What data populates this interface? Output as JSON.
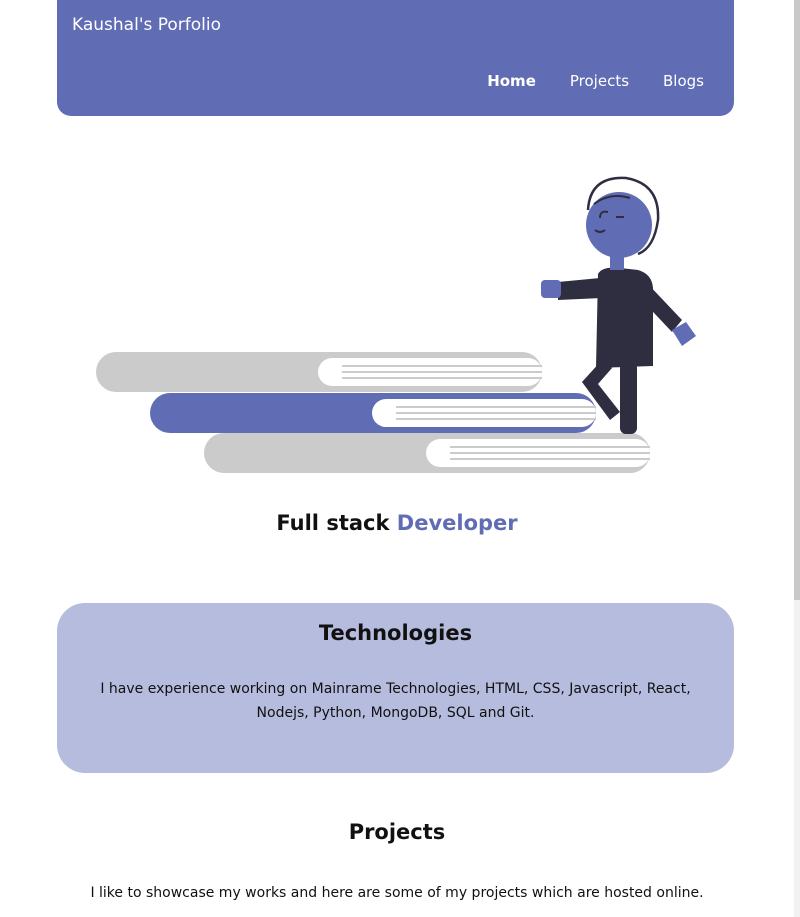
{
  "navbar": {
    "brand": "Kaushal's Porfolio",
    "links": [
      "Home",
      "Projects",
      "Blogs"
    ],
    "active_link": "Home",
    "background_color": "#606db5"
  },
  "hero": {
    "illustration": "person-climbing-books-illustration",
    "tagline_prefix": "Full stack",
    "tagline_accent": "Developer"
  },
  "technologies": {
    "title": "Technologies",
    "description": "I have experience working on Mainrame Technologies, HTML, CSS, Javascript, React, Nodejs, Python, MongoDB, SQL and Git.",
    "background_color": "#b6bcde"
  },
  "projects": {
    "title": "Projects",
    "description": "I like to showcase my works and here are some of my projects which are hosted online."
  },
  "theme": {
    "accent": "#606db5",
    "illustration_dark": "#2f2e41",
    "illustration_gray": "#cbcbcb"
  }
}
